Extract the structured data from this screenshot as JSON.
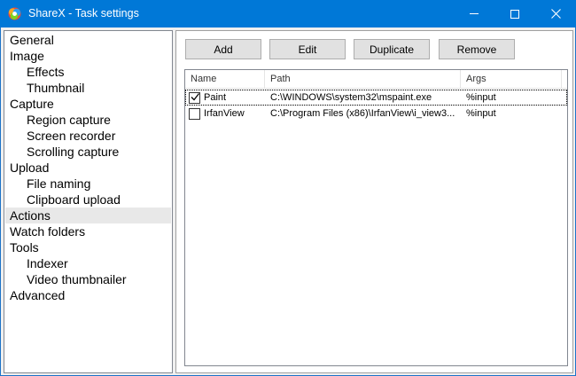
{
  "window": {
    "title": "ShareX - Task settings",
    "icon": "sharex-logo-icon",
    "controls": [
      "minimize-icon",
      "maximize-icon",
      "close-icon"
    ]
  },
  "sidebar": {
    "items": [
      {
        "label": "General",
        "level": 0,
        "selected": false
      },
      {
        "label": "Image",
        "level": 0,
        "selected": false
      },
      {
        "label": "Effects",
        "level": 1,
        "selected": false
      },
      {
        "label": "Thumbnail",
        "level": 1,
        "selected": false
      },
      {
        "label": "Capture",
        "level": 0,
        "selected": false
      },
      {
        "label": "Region capture",
        "level": 1,
        "selected": false
      },
      {
        "label": "Screen recorder",
        "level": 1,
        "selected": false
      },
      {
        "label": "Scrolling capture",
        "level": 1,
        "selected": false
      },
      {
        "label": "Upload",
        "level": 0,
        "selected": false
      },
      {
        "label": "File naming",
        "level": 1,
        "selected": false
      },
      {
        "label": "Clipboard upload",
        "level": 1,
        "selected": false
      },
      {
        "label": "Actions",
        "level": 0,
        "selected": true
      },
      {
        "label": "Watch folders",
        "level": 0,
        "selected": false
      },
      {
        "label": "Tools",
        "level": 0,
        "selected": false
      },
      {
        "label": "Indexer",
        "level": 1,
        "selected": false
      },
      {
        "label": "Video thumbnailer",
        "level": 1,
        "selected": false
      },
      {
        "label": "Advanced",
        "level": 0,
        "selected": false
      }
    ]
  },
  "toolbar": {
    "add_label": "Add",
    "edit_label": "Edit",
    "duplicate_label": "Duplicate",
    "remove_label": "Remove"
  },
  "actions_list": {
    "columns": {
      "name": "Name",
      "path": "Path",
      "args": "Args"
    },
    "rows": [
      {
        "checked": true,
        "name": "Paint",
        "path": "C:\\WINDOWS\\system32\\mspaint.exe",
        "args": "%input",
        "focused": true
      },
      {
        "checked": false,
        "name": "IrfanView",
        "path": "C:\\Program Files (x86)\\IrfanView\\i_view3...",
        "args": "%input",
        "focused": false
      }
    ]
  },
  "colors": {
    "titlebar": "#0078d7",
    "selection": "#e8e8e8"
  }
}
